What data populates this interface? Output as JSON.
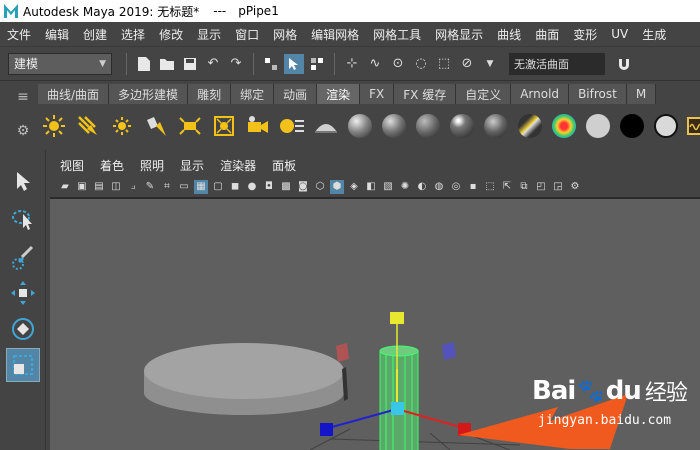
{
  "window": {
    "title": "Autodesk Maya 2019: 无标题*",
    "separator": "---",
    "object": "pPipe1"
  },
  "menubar": [
    "文件",
    "编辑",
    "创建",
    "选择",
    "修改",
    "显示",
    "窗口",
    "网格",
    "编辑网格",
    "网格工具",
    "网格显示",
    "曲线",
    "曲面",
    "变形",
    "UV",
    "生成"
  ],
  "statusline": {
    "mode": "建模",
    "live_surface": "无激活曲面"
  },
  "shelf": {
    "tabs": [
      "曲线/曲面",
      "多边形建模",
      "雕刻",
      "绑定",
      "动画",
      "渲染",
      "FX",
      "FX 缓存",
      "自定义",
      "Arnold",
      "Bifrost",
      "M"
    ],
    "active_tab": "渲染"
  },
  "viewport": {
    "menu": [
      "视图",
      "着色",
      "照明",
      "显示",
      "渲染器",
      "面板"
    ]
  },
  "colors": {
    "accent": "#5285a6",
    "viewport_bg": "#5f5f5f",
    "pipe_selected": "#3dff6a",
    "arrow": "#f05a1e"
  },
  "watermark": {
    "brand_a": "Bai",
    "brand_b": "du",
    "brand_cn": "经验",
    "url": "jingyan.baidu.com"
  }
}
